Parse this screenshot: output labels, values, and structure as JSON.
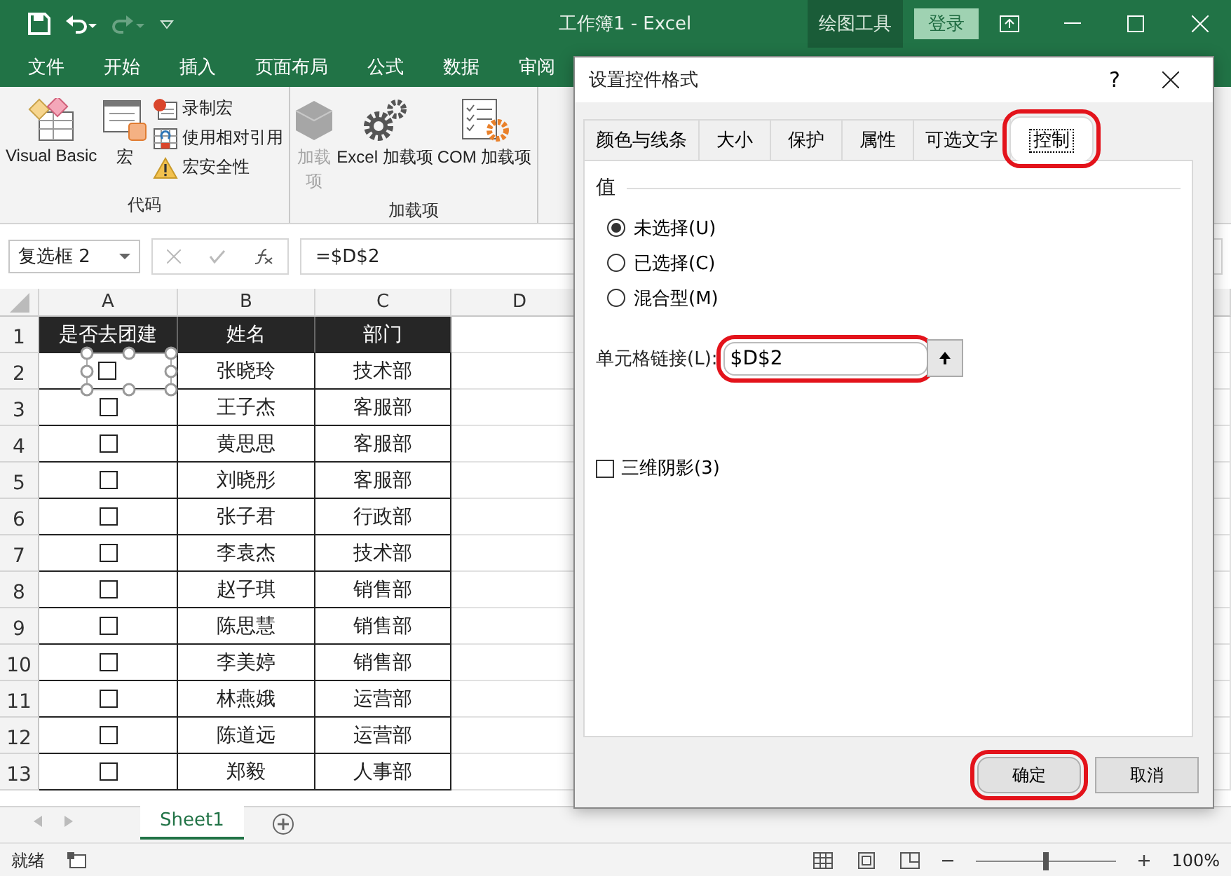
{
  "window": {
    "title": "工作簿1  -  Excel",
    "context_tab": "绘图工具",
    "login": "登录"
  },
  "ribbon_tabs": [
    "文件",
    "开始",
    "插入",
    "页面布局",
    "公式",
    "数据",
    "审阅"
  ],
  "ribbon_groups": [
    {
      "label": "代码",
      "commands": [
        {
          "kind": "large",
          "label": "Visual Basic",
          "disabled": false
        },
        {
          "kind": "large",
          "label": "宏",
          "disabled": false
        },
        {
          "kind": "stack",
          "items": [
            {
              "label": "录制宏"
            },
            {
              "label": "使用相对引用"
            },
            {
              "label": "宏安全性"
            }
          ]
        }
      ]
    },
    {
      "label": "加载项",
      "commands": [
        {
          "kind": "large",
          "label": "加载项",
          "disabled": true
        },
        {
          "kind": "large",
          "label": "Excel 加载项",
          "disabled": false
        },
        {
          "kind": "large",
          "label": "COM 加载项",
          "disabled": false
        }
      ]
    }
  ],
  "name_box": "复选框 2",
  "formula": "=$D$2",
  "sheet": {
    "columns": [
      "A",
      "B",
      "C",
      "D"
    ],
    "header": {
      "num": "1",
      "cells": [
        "是否去团建",
        "姓名",
        "部门"
      ]
    },
    "rows": [
      {
        "num": "2",
        "checked": false,
        "selected": true,
        "name": "张晓玲",
        "dept": "技术部"
      },
      {
        "num": "3",
        "checked": false,
        "selected": false,
        "name": "王子杰",
        "dept": "客服部"
      },
      {
        "num": "4",
        "checked": false,
        "selected": false,
        "name": "黄思思",
        "dept": "客服部"
      },
      {
        "num": "5",
        "checked": false,
        "selected": false,
        "name": "刘晓彤",
        "dept": "客服部"
      },
      {
        "num": "6",
        "checked": false,
        "selected": false,
        "name": "张子君",
        "dept": "行政部"
      },
      {
        "num": "7",
        "checked": false,
        "selected": false,
        "name": "李袁杰",
        "dept": "技术部"
      },
      {
        "num": "8",
        "checked": false,
        "selected": false,
        "name": "赵子琪",
        "dept": "销售部"
      },
      {
        "num": "9",
        "checked": false,
        "selected": false,
        "name": "陈思慧",
        "dept": "销售部"
      },
      {
        "num": "10",
        "checked": false,
        "selected": false,
        "name": "李美婷",
        "dept": "销售部"
      },
      {
        "num": "11",
        "checked": false,
        "selected": false,
        "name": "林燕娥",
        "dept": "运营部"
      },
      {
        "num": "12",
        "checked": false,
        "selected": false,
        "name": "陈道远",
        "dept": "运营部"
      },
      {
        "num": "13",
        "checked": false,
        "selected": false,
        "name": "郑毅",
        "dept": "人事部"
      }
    ]
  },
  "sheet_tabs": [
    {
      "label": "Sheet1",
      "selected": true
    }
  ],
  "status_bar": {
    "text": "就绪",
    "zoom": {
      "level": 0.5,
      "reading": "100%"
    }
  },
  "dialog": {
    "title": "设置控件格式",
    "help": "?",
    "tabs": [
      {
        "label": "颜色与线条",
        "selected": false,
        "highlighted": false
      },
      {
        "label": "大小",
        "selected": false,
        "highlighted": false
      },
      {
        "label": "保护",
        "selected": false,
        "highlighted": false
      },
      {
        "label": "属性",
        "selected": false,
        "highlighted": false
      },
      {
        "label": "可选文字",
        "selected": false,
        "highlighted": false
      },
      {
        "label": "控制",
        "selected": true,
        "highlighted": true
      }
    ],
    "section": "值",
    "radios": [
      {
        "label": "未选择(U)",
        "selected": true
      },
      {
        "label": "已选择(C)",
        "selected": false
      },
      {
        "label": "混合型(M)",
        "selected": false
      }
    ],
    "cell_link": {
      "label": "单元格链接(L):",
      "value": "$D$2",
      "highlighted": true
    },
    "shading": {
      "label": "三维阴影(3)",
      "checked": false
    },
    "buttons": [
      {
        "label": "确定",
        "highlighted": true
      },
      {
        "label": "取消",
        "highlighted": false
      }
    ]
  }
}
